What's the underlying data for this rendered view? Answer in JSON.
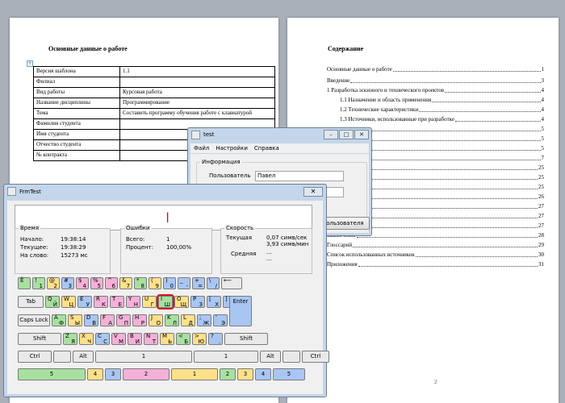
{
  "doc_page1": {
    "title": "Основные данные о работе",
    "rows": [
      {
        "k": "Версия шаблона",
        "v": "1.1"
      },
      {
        "k": "Филиал",
        "v": ""
      },
      {
        "k": "Вид работы",
        "v": "Курсовая работа"
      },
      {
        "k": "Название дисциплины",
        "v": "Программирование"
      },
      {
        "k": "Тема",
        "v": "Составить программу обучения работе с клавиатурой"
      },
      {
        "k": "Фамилия студента",
        "v": ""
      },
      {
        "k": "Имя студента",
        "v": ""
      },
      {
        "k": "Отчество студента",
        "v": ""
      },
      {
        "k": "№ контракта",
        "v": ""
      }
    ]
  },
  "doc_page2": {
    "title": "Содержание",
    "toc": [
      {
        "t": "Основные данные о работе",
        "n": "1",
        "ind": false
      },
      {
        "t": "Введение",
        "n": "3",
        "ind": false
      },
      {
        "t": "1 Разработка эскизного и технического проектов",
        "n": "4",
        "ind": false
      },
      {
        "t": "1.1   Назначение и область применения",
        "n": "4",
        "ind": true
      },
      {
        "t": "1.2   Технические характеристики",
        "n": "4",
        "ind": true
      },
      {
        "t": "1.3   Источники, использованные при разработке",
        "n": "4",
        "ind": true
      },
      {
        "t": "рочего проекта",
        "n": "5",
        "ind": false
      },
      {
        "t": "граммы",
        "n": "5",
        "ind": false
      },
      {
        "t": "программы",
        "n": "5",
        "ind": false
      },
      {
        "t": "мы",
        "n": "7",
        "ind": false
      },
      {
        "t": "граммы",
        "n": "25",
        "ind": false
      },
      {
        "t": "граммы",
        "n": "25",
        "ind": false
      },
      {
        "t": "ы",
        "n": "25",
        "ind": false
      },
      {
        "t": "рузка",
        "n": "26",
        "ind": false
      },
      {
        "t": "",
        "n": "27",
        "ind": false
      },
      {
        "t": "данные",
        "n": "27",
        "ind": false
      },
      {
        "t": "программы",
        "n": "27",
        "ind": false
      },
      {
        "t": "Заключение",
        "n": "28",
        "ind": false
      },
      {
        "t": "Глоссарий",
        "n": "29",
        "ind": false
      },
      {
        "t": "Список использованных источников",
        "n": "30",
        "ind": false
      },
      {
        "t": "Приложения",
        "n": "31",
        "ind": false
      }
    ],
    "page_number": "2"
  },
  "test_window": {
    "title": "test",
    "menu": [
      "Файл",
      "Настройки",
      "Справка"
    ],
    "group": "Информация",
    "user_label": "Пользователь",
    "user_value": "Павел",
    "button": "ь пользователя"
  },
  "frm": {
    "title": "FrmTest",
    "cursor": "|",
    "time": {
      "title": "Время",
      "start_l": "Начало:",
      "start": "19:38:14",
      "cur_l": "Текущее:",
      "cur": "19:38:29",
      "word_l": "На слово:",
      "word": "15273 мс"
    },
    "errors": {
      "title": "Ошибки",
      "total_l": "Всего:",
      "total": "1",
      "pct_l": "Процент:",
      "pct": "100,00%"
    },
    "speed": {
      "title": "Скорость",
      "cur_l": "Текущая",
      "cur1": "0,07 симв/сек",
      "cur2": "3,93 симв/мин",
      "avg_l": "Средняя",
      "avg1": "...",
      "avg2": "..."
    }
  },
  "keyboard": {
    "colors": {
      "green": "#a8e0a0",
      "yellow": "#ffe08a",
      "blue": "#a9c6f2",
      "pink": "#f5b0d8",
      "gray": "#e9e9e9",
      "red": "#d81818"
    },
    "rows": [
      [
        {
          "t": "Ё",
          "b": "",
          "c": "green",
          "w": 16
        },
        {
          "t": "!",
          "b": "1",
          "c": "green",
          "w": 16
        },
        {
          "t": "@",
          "b": "2",
          "c": "yellow",
          "w": 16
        },
        {
          "t": "#",
          "b": "3",
          "c": "blue",
          "w": 16
        },
        {
          "t": "$",
          "b": "4",
          "c": "pink",
          "w": 16
        },
        {
          "t": "%",
          "b": "5",
          "c": "pink",
          "w": 16
        },
        {
          "t": "^",
          "b": "6",
          "c": "pink",
          "w": 16
        },
        {
          "t": "&",
          "b": "7",
          "c": "yellow",
          "w": 16
        },
        {
          "t": "*",
          "b": "8",
          "c": "green",
          "w": 16
        },
        {
          "t": "(",
          "b": "9",
          "c": "yellow",
          "w": 16
        },
        {
          "t": ")",
          "b": "0",
          "c": "blue",
          "w": 16
        },
        {
          "t": "_",
          "b": "-",
          "c": "blue",
          "w": 16
        },
        {
          "t": "+",
          "b": "=",
          "c": "blue",
          "w": 16
        },
        {
          "t": "\\",
          "b": "/",
          "c": "blue",
          "w": 16
        },
        {
          "t": "⟵",
          "b": "",
          "c": "gray",
          "w": 26
        }
      ],
      [
        {
          "t": "Tab",
          "b": "",
          "c": "gray",
          "w": 32,
          "center": true
        },
        {
          "t": "Q",
          "b": "Й",
          "c": "green",
          "w": 18
        },
        {
          "t": "W",
          "b": "Ц",
          "c": "yellow",
          "w": 18
        },
        {
          "t": "E",
          "b": "У",
          "c": "blue",
          "w": 18
        },
        {
          "t": "R",
          "b": "К",
          "c": "pink",
          "w": 18
        },
        {
          "t": "T",
          "b": "Е",
          "c": "pink",
          "w": 18
        },
        {
          "t": "Y",
          "b": "Н",
          "c": "pink",
          "w": 18
        },
        {
          "t": "U",
          "b": "Г",
          "c": "yellow",
          "w": 18
        },
        {
          "t": "I",
          "b": "Ш",
          "c": "green",
          "w": 18,
          "hl": true
        },
        {
          "t": "O",
          "b": "Щ",
          "c": "yellow",
          "w": 18
        },
        {
          "t": "P",
          "b": "З",
          "c": "blue",
          "w": 18
        },
        {
          "t": "[",
          "b": "Х",
          "c": "blue",
          "w": 18
        },
        {
          "t": "]",
          "b": "Ъ",
          "c": "blue",
          "w": 18
        }
      ],
      [
        {
          "t": "Caps Lock",
          "b": "",
          "c": "gray",
          "w": 40,
          "center": true
        },
        {
          "t": "A",
          "b": "Ф",
          "c": "green",
          "w": 18
        },
        {
          "t": "S",
          "b": "Ы",
          "c": "yellow",
          "w": 18
        },
        {
          "t": "D",
          "b": "В",
          "c": "blue",
          "w": 18
        },
        {
          "t": "F",
          "b": "А",
          "c": "pink",
          "w": 18
        },
        {
          "t": "G",
          "b": "П",
          "c": "pink",
          "w": 18
        },
        {
          "t": "H",
          "b": "Р",
          "c": "pink",
          "w": 18
        },
        {
          "t": "J",
          "b": "О",
          "c": "yellow",
          "w": 18
        },
        {
          "t": "K",
          "b": "Л",
          "c": "green",
          "w": 18
        },
        {
          "t": "L",
          "b": "Д",
          "c": "yellow",
          "w": 18
        },
        {
          "t": ";",
          "b": "Ж",
          "c": "blue",
          "w": 18
        },
        {
          "t": "'",
          "b": "Э",
          "c": "blue",
          "w": 18
        },
        {
          "t": "Enter",
          "b": "",
          "c": "blue",
          "w": 28,
          "center": true
        }
      ],
      [
        {
          "t": "Shift",
          "b": "",
          "c": "gray",
          "w": 54,
          "center": true
        },
        {
          "t": "Z",
          "b": "Я",
          "c": "green",
          "w": 18
        },
        {
          "t": "X",
          "b": "Ч",
          "c": "yellow",
          "w": 18
        },
        {
          "t": "C",
          "b": "С",
          "c": "blue",
          "w": 18
        },
        {
          "t": "V",
          "b": "М",
          "c": "pink",
          "w": 18
        },
        {
          "t": "B",
          "b": "И",
          "c": "pink",
          "w": 18
        },
        {
          "t": "N",
          "b": "Т",
          "c": "pink",
          "w": 18
        },
        {
          "t": "M",
          "b": "Ь",
          "c": "yellow",
          "w": 18
        },
        {
          "t": "<",
          "b": "Б",
          "c": "green",
          "w": 18
        },
        {
          "t": ">",
          "b": "Ю",
          "c": "yellow",
          "w": 18
        },
        {
          "t": "?",
          "b": ".",
          "c": "blue",
          "w": 18
        },
        {
          "t": "Shift",
          "b": "",
          "c": "gray",
          "w": 54,
          "center": true
        }
      ],
      [
        {
          "t": "Ctrl",
          "b": "",
          "c": "gray",
          "w": 42,
          "center": true
        },
        {
          "t": "",
          "b": "",
          "c": "gray",
          "w": 22
        },
        {
          "t": "Alt",
          "b": "",
          "c": "gray",
          "w": 26,
          "center": true
        },
        {
          "t": "1",
          "b": "",
          "c": "gray",
          "w": 120,
          "center": true
        },
        {
          "t": "1",
          "b": "",
          "c": "gray",
          "w": 80,
          "center": true
        },
        {
          "t": "Alt",
          "b": "",
          "c": "gray",
          "w": 26,
          "center": true
        },
        {
          "t": "",
          "b": "",
          "c": "gray",
          "w": 22
        },
        {
          "t": "Ctrl",
          "b": "",
          "c": "gray",
          "w": 34,
          "center": true
        }
      ],
      [
        {
          "t": "5",
          "b": "",
          "c": "green",
          "w": 84,
          "center": true
        },
        {
          "t": "4",
          "b": "",
          "c": "yellow",
          "w": 20,
          "center": true
        },
        {
          "t": "3",
          "b": "",
          "c": "blue",
          "w": 20,
          "center": true
        },
        {
          "t": "2",
          "b": "",
          "c": "pink",
          "w": 58,
          "center": true
        },
        {
          "t": "1",
          "b": "",
          "c": "yellow",
          "w": 58,
          "center": true
        },
        {
          "t": "2",
          "b": "",
          "c": "green",
          "w": 20,
          "center": true
        },
        {
          "t": "3",
          "b": "",
          "c": "yellow",
          "w": 20,
          "center": true
        },
        {
          "t": "4",
          "b": "",
          "c": "blue",
          "w": 20,
          "center": true
        },
        {
          "t": "5",
          "b": "",
          "c": "blue",
          "w": 40,
          "center": true
        }
      ]
    ]
  }
}
